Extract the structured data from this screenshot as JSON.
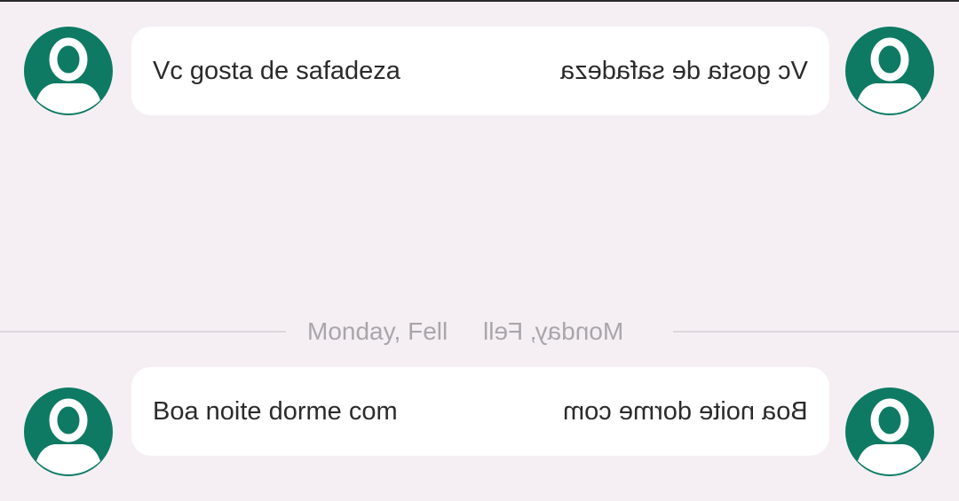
{
  "messages": [
    {
      "text_left": "Vc gosta de safadeza",
      "text_right_mirrored": "Vc gosta de safadeza"
    },
    {
      "text_left": "Boa noite dorme com",
      "text_right_mirrored": "Boa noite dorme com"
    }
  ],
  "date_divider": {
    "text_left": "Monday, Fell",
    "text_right_mirrored": "Monday, Fell"
  },
  "colors": {
    "background": "#f5eff4",
    "avatar": "#0e7a64",
    "bubble": "#ffffff",
    "date_text": "#a9a6aa"
  },
  "icons": {
    "avatar": "person-icon"
  }
}
